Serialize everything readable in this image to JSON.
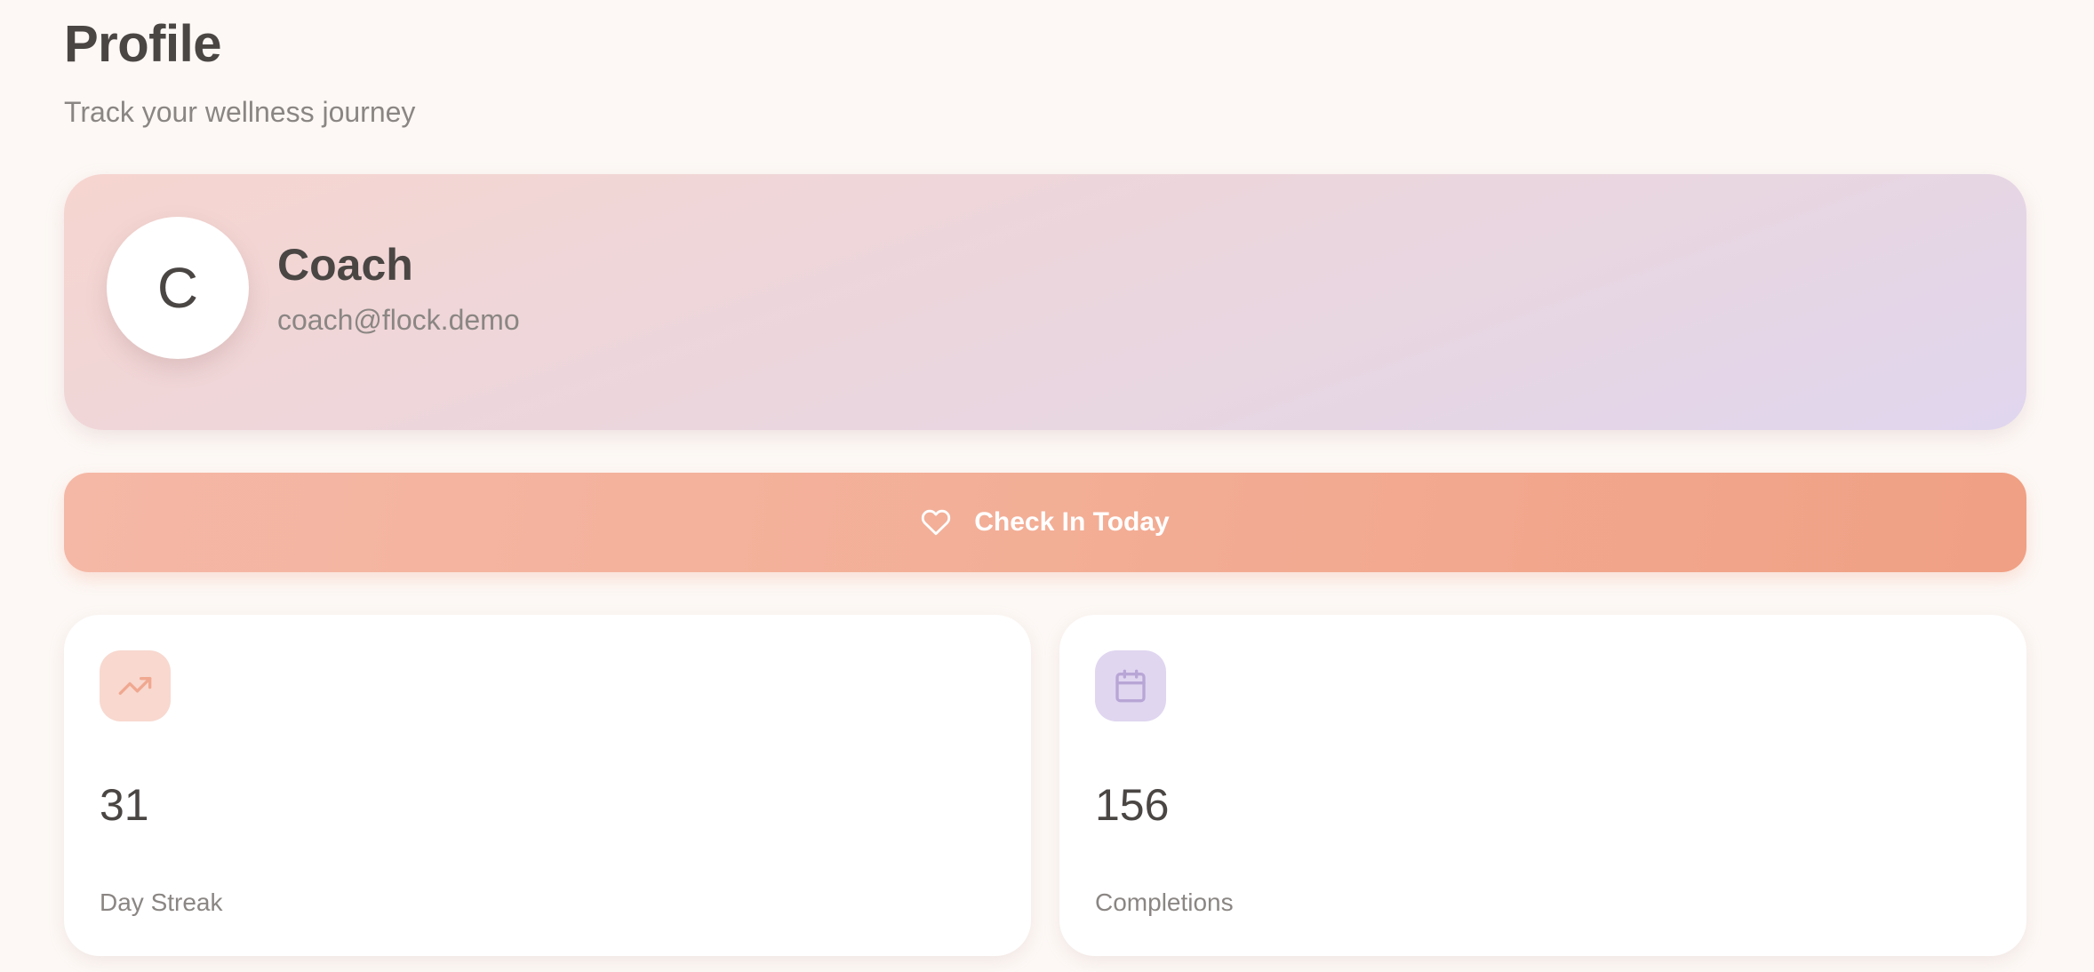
{
  "header": {
    "title": "Profile",
    "subtitle": "Track your wellness journey"
  },
  "profile": {
    "avatar_initial": "C",
    "name": "Coach",
    "email": "coach@flock.demo"
  },
  "checkin": {
    "label": "Check In Today",
    "icon": "heart-icon"
  },
  "stats": [
    {
      "icon": "trending-up-icon",
      "value": "31",
      "label": "Day Streak"
    },
    {
      "icon": "calendar-icon",
      "value": "156",
      "label": "Completions"
    }
  ],
  "colors": {
    "background": "#fdf8f5",
    "accent": "#f3ae96",
    "peach_icon_bg": "#f8d8cf",
    "lavender_icon_bg": "#e0d6f0"
  }
}
